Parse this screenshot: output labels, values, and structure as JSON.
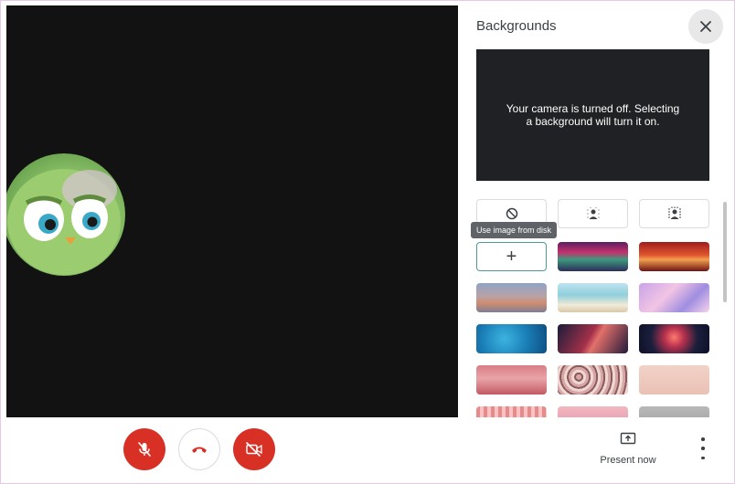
{
  "panel": {
    "title": "Backgrounds",
    "close_icon": "close-icon",
    "preview_text": "Your camera is turned off. Selecting a background will turn it on.",
    "options": [
      {
        "name": "no-effect",
        "icon": "block-icon"
      },
      {
        "name": "slight-blur",
        "icon": "blur-person-icon"
      },
      {
        "name": "blur",
        "icon": "blur-person-icon"
      }
    ],
    "upload_tooltip": "Use image from disk",
    "upload_icon": "plus-icon",
    "backgrounds": [
      "classroom",
      "fireworks-city",
      "sunset-sky",
      "beach",
      "pink-clouds",
      "underwater",
      "nebula",
      "fireworks",
      "cherry-blossom",
      "pebbles",
      "soft-pink",
      "pink-pattern",
      "pink-flowers",
      "grey-texture"
    ]
  },
  "controls": {
    "mic_icon": "mic-off-icon",
    "hangup_icon": "hang-up-icon",
    "camera_icon": "camera-off-icon",
    "present_label": "Present now",
    "present_icon": "present-screen-icon",
    "more_icon": "more-vert-icon"
  },
  "colors": {
    "accent_red": "#d93025",
    "upload_border": "#4f9a96",
    "video_bg": "#121212"
  }
}
